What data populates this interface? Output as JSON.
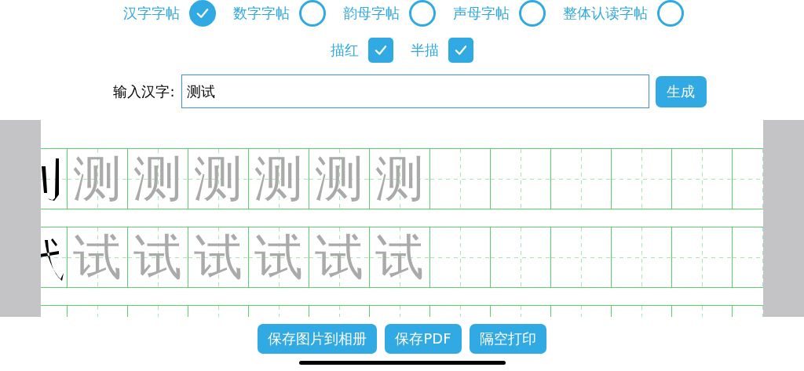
{
  "modes": [
    {
      "label": "汉字字帖",
      "selected": true
    },
    {
      "label": "数字字帖",
      "selected": false
    },
    {
      "label": "韵母字帖",
      "selected": false
    },
    {
      "label": "声母字帖",
      "selected": false
    },
    {
      "label": "整体认读字帖",
      "selected": false
    }
  ],
  "options": [
    {
      "label": "描红",
      "checked": true
    },
    {
      "label": "半描",
      "checked": true
    }
  ],
  "input": {
    "label": "输入汉字:",
    "value": "测试"
  },
  "generate_button": "生成",
  "sheet_rows": [
    {
      "traces": [
        "测",
        "测",
        "测",
        "测",
        "测",
        "测"
      ]
    },
    {
      "traces": [
        "试",
        "试",
        "试",
        "试",
        "试",
        "试"
      ]
    },
    {
      "traces": []
    }
  ],
  "actions": [
    "保存图片到相册",
    "保存PDF",
    "隔空打印"
  ]
}
